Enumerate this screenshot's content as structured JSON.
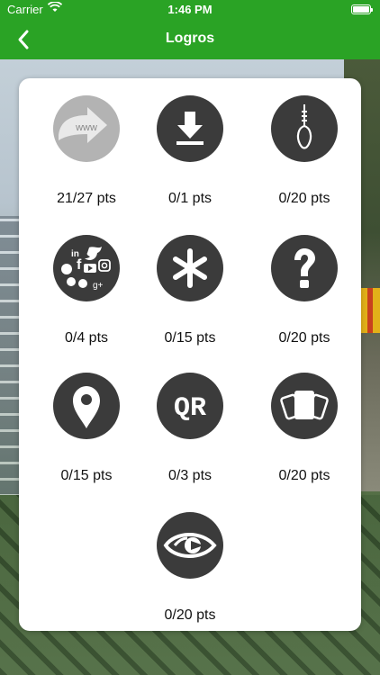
{
  "status_bar": {
    "carrier": "Carrier",
    "time": "1:46 PM"
  },
  "nav": {
    "title": "Logros"
  },
  "achievements": [
    {
      "icon": "web-link-icon",
      "points": "21/27 pts"
    },
    {
      "icon": "download-icon",
      "points": "0/1 pts"
    },
    {
      "icon": "hangman-noose-icon",
      "points": "0/20 pts"
    },
    {
      "icon": "social-networks-icon",
      "points": "0/4 pts",
      "social_labels": [
        "in",
        "f",
        "g+"
      ]
    },
    {
      "icon": "asterisk-icon",
      "points": "0/15 pts"
    },
    {
      "icon": "question-mark-icon",
      "points": "0/20 pts"
    },
    {
      "icon": "location-pin-icon",
      "points": "0/15 pts"
    },
    {
      "icon": "qr-code-icon",
      "points": "0/3 pts",
      "label": "QR"
    },
    {
      "icon": "cards-icon",
      "points": "0/20 pts"
    },
    {
      "icon": "eye-icon",
      "points": "0/20 pts"
    }
  ],
  "web_badge_text": "www",
  "colors": {
    "brand_green": "#2aa325",
    "badge_dark": "#3b3b3b",
    "badge_light": "#b3b3b3"
  }
}
